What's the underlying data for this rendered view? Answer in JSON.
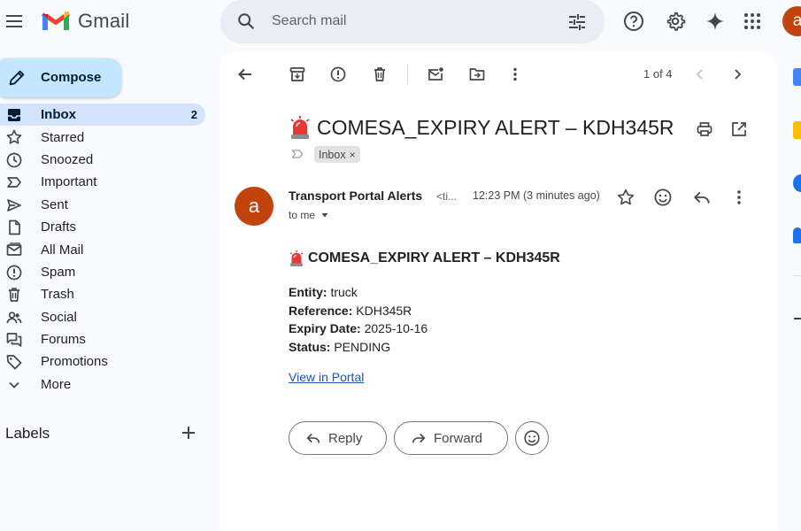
{
  "app": {
    "name": "Gmail",
    "brand_color": "#ea4335"
  },
  "search": {
    "placeholder": "Search mail"
  },
  "user": {
    "avatar_letter": "a",
    "avatar_color": "#c1440e"
  },
  "compose": {
    "label": "Compose"
  },
  "nav": [
    {
      "label": "Inbox",
      "count": "2",
      "icon": "inbox-icon",
      "active": true
    },
    {
      "label": "Starred",
      "icon": "star-icon"
    },
    {
      "label": "Snoozed",
      "icon": "clock-icon"
    },
    {
      "label": "Important",
      "icon": "important-icon"
    },
    {
      "label": "Sent",
      "icon": "send-icon"
    },
    {
      "label": "Drafts",
      "icon": "draft-icon"
    },
    {
      "label": "All Mail",
      "icon": "all-mail-icon"
    },
    {
      "label": "Spam",
      "icon": "spam-icon"
    },
    {
      "label": "Trash",
      "icon": "trash-icon"
    },
    {
      "label": "Social",
      "icon": "people-icon"
    },
    {
      "label": "Forums",
      "icon": "forum-icon"
    },
    {
      "label": "Promotions",
      "icon": "tag-icon"
    },
    {
      "label": "More",
      "icon": "chevron-down-icon"
    }
  ],
  "labels": {
    "title": "Labels"
  },
  "toolbar": {
    "pager": "1 of 4"
  },
  "message": {
    "subject": "COMESA_EXPIRY ALERT – KDH345R",
    "label_chip": "Inbox",
    "label_chip_close": "×",
    "sender_name": "Transport Portal Alerts",
    "sender_email": "<ti...",
    "sender_avatar_letter": "a",
    "recipient": "to me",
    "time": "12:23 PM (3 minutes ago)",
    "body": {
      "title": "COMESA_EXPIRY ALERT – KDH345R",
      "entity_label": "Entity:",
      "entity_value": " truck",
      "reference_label": "Reference:",
      "reference_value": " KDH345R",
      "expiry_label": "Expiry Date:",
      "expiry_value": " 2025-10-16",
      "status_label": "Status:",
      "status_value": " PENDING",
      "link_text": "View in Portal"
    }
  },
  "actions": {
    "reply_label": "Reply",
    "forward_label": "Forward"
  }
}
